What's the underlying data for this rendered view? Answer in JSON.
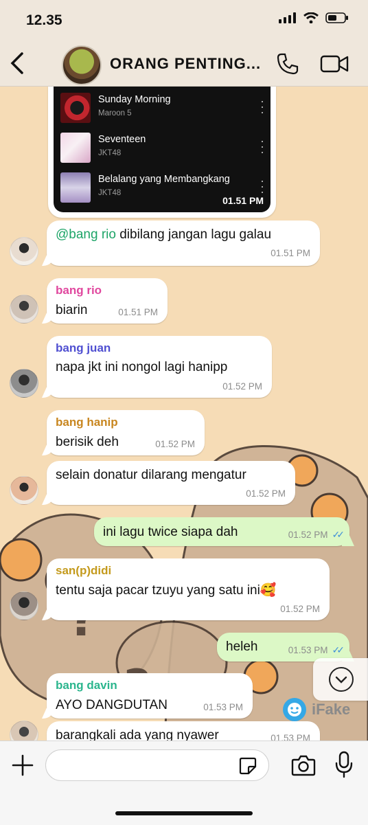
{
  "status_bar": {
    "time": "12.35"
  },
  "header": {
    "title": "ORANG PENTING..."
  },
  "music_card": {
    "tracks": [
      {
        "title": "Sunday Morning",
        "artist": "Maroon 5"
      },
      {
        "title": "Seventeen",
        "artist": "JKT48"
      },
      {
        "title": "Belalang yang Membangkang",
        "artist": "JKT48"
      }
    ],
    "time": "01.51 PM"
  },
  "messages": [
    {
      "mention": "@bang rio",
      "text": " dibilang jangan lagu galau",
      "time": "01.51 PM"
    },
    {
      "sender": "bang rio",
      "sender_color": "#e0479e",
      "text": "biarin",
      "time": "01.51 PM"
    },
    {
      "sender": "bang juan",
      "sender_color": "#4f4fd1",
      "text": "napa jkt ini nongol lagi hanipp",
      "time": "01.52 PM"
    },
    {
      "sender": "bang hanip",
      "sender_color": "#c8861f",
      "text": "berisik deh",
      "time": "01.52 PM"
    },
    {
      "text": "selain donatur dilarang mengatur",
      "time": "01.52 PM"
    },
    {
      "text": "ini lagu twice siapa dah",
      "time": "01.52 PM",
      "outgoing": true
    },
    {
      "sender": "san(p)didi",
      "sender_color": "#c49a1c",
      "text": "tentu saja pacar tzuyu yang satu ini🥰",
      "time": "01.52 PM"
    },
    {
      "text": "heleh",
      "time": "01.53 PM",
      "outgoing": true
    },
    {
      "sender": "bang davin",
      "sender_color": "#2bb58d",
      "text": "AYO DANGDUTAN",
      "time": "01.53 PM"
    },
    {
      "text": "barangkali ada yang nyawer",
      "time": "01.53 PM"
    }
  ],
  "watermark": {
    "text": "iFake"
  },
  "input": {
    "placeholder": ""
  },
  "colors": {
    "outgoing_bubble": "#dcf8c6",
    "read_ticks": "#3e8fd9",
    "wallpaper": "#f6dcb6"
  }
}
